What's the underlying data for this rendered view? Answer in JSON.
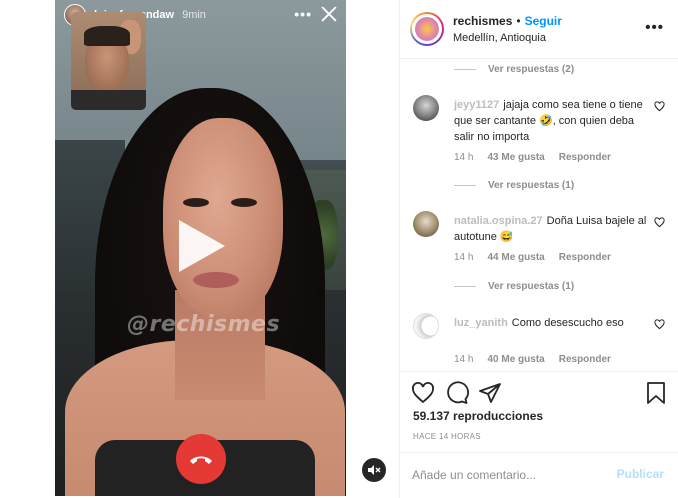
{
  "story": {
    "username": "luisafernandaw",
    "time": "9min",
    "more_label": "•••",
    "watermark": "@rechismes",
    "icons": {
      "close": "close-icon",
      "play": "play-icon",
      "end_call": "phone-hangup-icon",
      "mute": "speaker-muted-icon"
    }
  },
  "post": {
    "username": "rechismes",
    "separator": "•",
    "follow_label": "Seguir",
    "location": "Medellín, Antioquia",
    "more_label": "•••"
  },
  "comments": {
    "replies_top": "Ver respuestas (2)",
    "items": [
      {
        "user": "jeyy1127",
        "text": "jajaja como sea tiene o tiene que ser cantante 🤣, con quien deba salir no importa",
        "time": "14 h",
        "likes": "43 Me gusta",
        "reply_label": "Responder",
        "replies": "Ver respuestas (1)"
      },
      {
        "user": "natalia.ospina.27",
        "text": "Doña Luisa bajele al autotune 😅",
        "time": "14 h",
        "likes": "44 Me gusta",
        "reply_label": "Responder",
        "replies": "Ver respuestas (1)"
      },
      {
        "user": "luz_yanith",
        "text": "Como desescucho eso",
        "time": "14 h",
        "likes": "40 Me gusta",
        "reply_label": "Responder"
      }
    ]
  },
  "actions": {
    "views": "59.137 reproducciones",
    "posted": "HACE 14 HORAS",
    "icons": [
      "heart-icon",
      "comment-icon",
      "share-icon",
      "save-icon"
    ]
  },
  "add_comment": {
    "placeholder": "Añade un comentario...",
    "publish_label": "Publicar"
  },
  "colors": {
    "accent": "#0095f6",
    "publish_disabled": "#b2dffc",
    "end_call": "#e53935",
    "muted_text": "#8e8e8e"
  }
}
